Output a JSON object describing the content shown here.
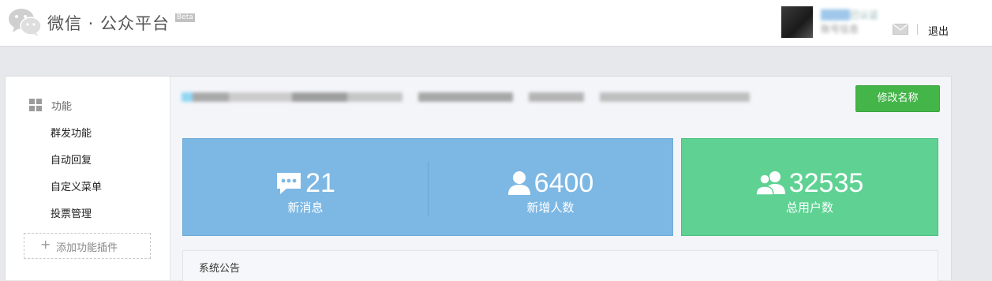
{
  "header": {
    "brand": "微信 · 公众平台",
    "beta": "Beta",
    "user_name": "已认证",
    "user_sub": "账号信息",
    "logout": "退出"
  },
  "sidebar": {
    "section": "功能",
    "items": [
      "群发功能",
      "自动回复",
      "自定义菜单",
      "投票管理"
    ],
    "add_plugin": "添加功能插件"
  },
  "main": {
    "rename_button": "修改名称",
    "stats": {
      "messages": {
        "value": "21",
        "label": "新消息",
        "icon": "chat-bubble-icon"
      },
      "new_users": {
        "value": "6400",
        "label": "新增人数",
        "icon": "user-icon"
      },
      "total_users": {
        "value": "32535",
        "label": "总用户数",
        "icon": "users-icon"
      }
    },
    "notice_title": "系统公告"
  },
  "colors": {
    "stat_blue": "#7db8e4",
    "stat_green": "#5fd293",
    "primary_button": "#44b549"
  }
}
